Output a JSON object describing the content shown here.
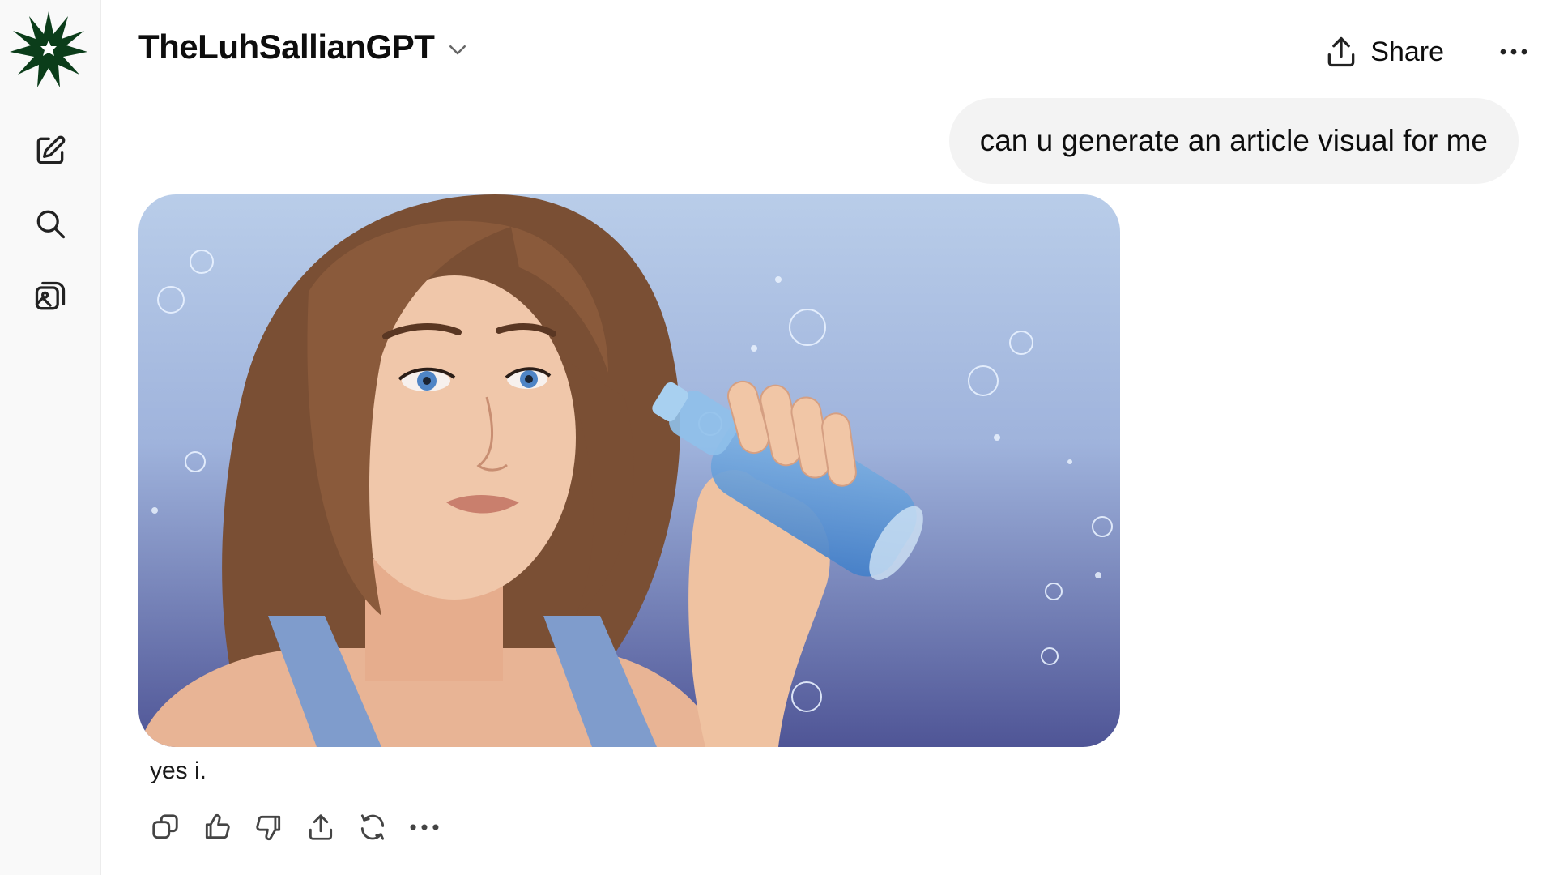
{
  "app": {
    "title": "TheLuhSallianGPT",
    "brand_color": "#0b3d1a",
    "logo_icon": "star-burst-logo"
  },
  "sidebar": {
    "items": [
      {
        "name": "new-chat",
        "icon": "compose-icon"
      },
      {
        "name": "search",
        "icon": "search-icon"
      },
      {
        "name": "library",
        "icon": "image-gallery-icon"
      }
    ]
  },
  "header": {
    "share_label": "Share",
    "share_icon": "upload-icon",
    "more_icon": "ellipsis-icon",
    "title_dropdown_icon": "chevron-down-icon"
  },
  "conversation": {
    "user_message": "can u generate an article visual for me",
    "assistant_reply": "yes i.",
    "generated_image_icon": "generated-illustration"
  },
  "message_actions": [
    {
      "name": "copy",
      "icon": "copy-icon"
    },
    {
      "name": "thumbs-up",
      "icon": "thumbs-up-icon"
    },
    {
      "name": "thumbs-down",
      "icon": "thumbs-down-icon"
    },
    {
      "name": "share",
      "icon": "share-icon"
    },
    {
      "name": "regenerate",
      "icon": "regenerate-icon"
    },
    {
      "name": "more",
      "icon": "ellipsis-icon"
    }
  ],
  "colors": {
    "user_bubble_bg": "#f3f3f3",
    "sidebar_bg": "#f9f9f9",
    "text": "#0d0d0d"
  }
}
